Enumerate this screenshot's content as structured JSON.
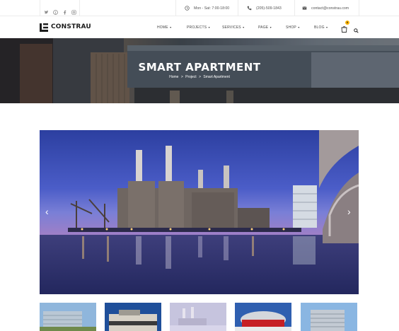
{
  "topbar": {
    "social_icons": [
      "twitter-icon",
      "pinterest-icon",
      "facebook-icon",
      "instagram-icon"
    ],
    "hours": "Mon - Sat: 7:00-18:00",
    "phone": "(205)-509-1843",
    "email": "contact@constrau.com"
  },
  "brand": {
    "name": "CONSTRAU"
  },
  "nav": {
    "items": [
      {
        "label": "HOME"
      },
      {
        "label": "PROJECTS"
      },
      {
        "label": "SERVICES"
      },
      {
        "label": "PAGE"
      },
      {
        "label": "SHOP"
      },
      {
        "label": "BLOG"
      }
    ],
    "cart_count": "0"
  },
  "banner": {
    "title": "SMART APARTMENT",
    "breadcrumb": [
      "Home",
      "Project",
      "Smart Apartment"
    ],
    "separator": ">"
  },
  "slider": {
    "prev_arrow": "‹",
    "next_arrow": "›"
  },
  "colors": {
    "accent": "#ffb600",
    "dark": "#1c1c1c",
    "border": "#ececec"
  }
}
